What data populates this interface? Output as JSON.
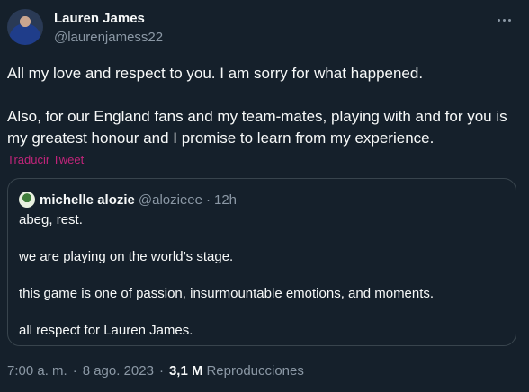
{
  "author": {
    "name": "Lauren James",
    "handle": "@laurenjamess22"
  },
  "tweet": {
    "paragraphs": [
      "All my love and respect to you. I am sorry for what happened.",
      "Also, for our England fans and my team-mates, playing with and for you is my greatest honour and I promise to learn from my experience."
    ],
    "translate_label": "Traducir Tweet"
  },
  "quote": {
    "name": "michelle alozie",
    "handle": "@alozieee",
    "separator": "·",
    "time": "12h",
    "lines": [
      "abeg, rest.",
      "we are playing on the world’s stage.",
      "this game is one of passion, insurmountable emotions, and moments.",
      "all respect for Lauren James."
    ]
  },
  "meta": {
    "time": "7:00 a. m.",
    "separator": "·",
    "date": "8 ago. 2023",
    "views_count": "3,1 M",
    "views_label": "Reproducciones"
  },
  "icons": {
    "more": "more-horizontal-icon"
  },
  "colors": {
    "background": "#15202b",
    "text": "#f7f9f9",
    "secondary": "#8b98a5",
    "translate": "#c0247a",
    "border": "#38444d"
  }
}
